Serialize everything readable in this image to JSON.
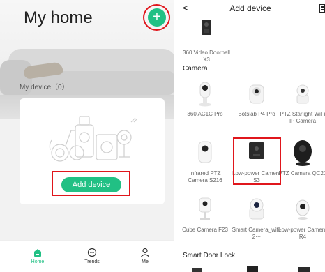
{
  "home": {
    "title": "My home",
    "add_symbol": "+",
    "device_count": "My device（0）",
    "add_device_label": "Add device"
  },
  "tabbar": {
    "items": [
      {
        "label": "Home",
        "icon": "home-icon",
        "active": true
      },
      {
        "label": "Trends",
        "icon": "trends-icon"
      },
      {
        "label": "Me",
        "icon": "person-icon"
      }
    ]
  },
  "add_device": {
    "back": "<",
    "title": "Add device",
    "doorbell": "360 Video Doorbell X3",
    "camera_section": "Camera",
    "cameras": [
      "360 AC1C Pro",
      "Botslab P4 Pro",
      "PTZ Starlight WiFi IP Camera",
      "Infrared PTZ Camera S216",
      "Low-power Camera S3",
      "PTZ Camera QC21",
      "Cube Camera F23",
      "Smart Camera_wifi-2···",
      "Low-power Camera R4"
    ],
    "lock_section": "Smart Door Lock"
  },
  "colors": {
    "accent": "#21c084",
    "highlight": "#e0161c"
  }
}
